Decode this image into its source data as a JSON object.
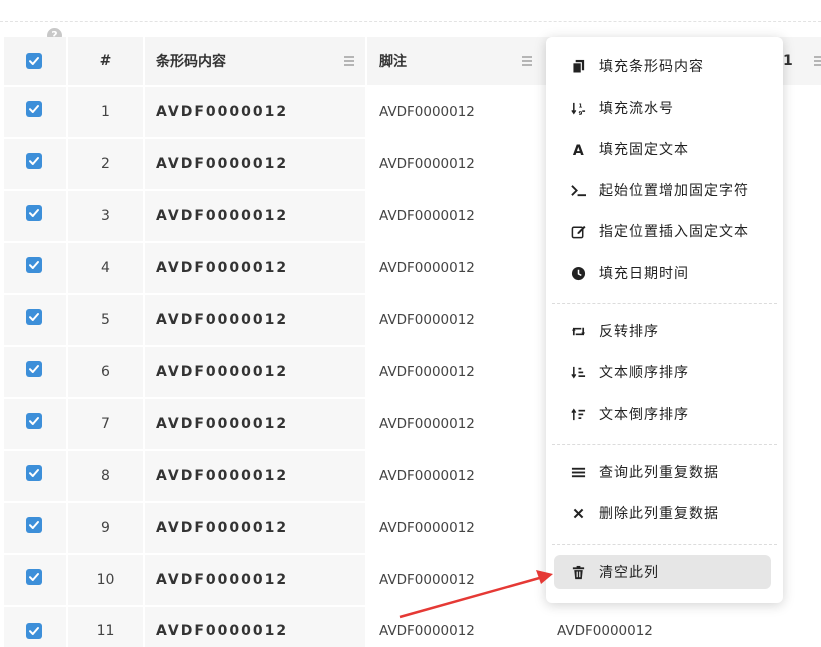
{
  "table": {
    "header": {
      "index": "#",
      "barcode": "条形码内容",
      "note": "脚注",
      "extra_partial": "1"
    },
    "rows": [
      {
        "index": "1",
        "barcode": "AVDF0000012",
        "note": "AVDF0000012"
      },
      {
        "index": "2",
        "barcode": "AVDF0000012",
        "note": "AVDF0000012"
      },
      {
        "index": "3",
        "barcode": "AVDF0000012",
        "note": "AVDF0000012"
      },
      {
        "index": "4",
        "barcode": "AVDF0000012",
        "note": "AVDF0000012"
      },
      {
        "index": "5",
        "barcode": "AVDF0000012",
        "note": "AVDF0000012"
      },
      {
        "index": "6",
        "barcode": "AVDF0000012",
        "note": "AVDF0000012"
      },
      {
        "index": "7",
        "barcode": "AVDF0000012",
        "note": "AVDF0000012"
      },
      {
        "index": "8",
        "barcode": "AVDF0000012",
        "note": "AVDF0000012"
      },
      {
        "index": "9",
        "barcode": "AVDF0000012",
        "note": "AVDF0000012"
      },
      {
        "index": "10",
        "barcode": "AVDF0000012",
        "note": "AVDF0000012"
      },
      {
        "index": "11",
        "barcode": "AVDF0000012",
        "note": "AVDF0000012",
        "extra": "AVDF0000012"
      }
    ],
    "checkbox_color": "#3d8fd9"
  },
  "context_menu": {
    "groups": [
      [
        {
          "label": "填充条形码内容",
          "icon": "copy-icon"
        },
        {
          "label": "填充流水号",
          "icon": "sort-numeric-icon"
        },
        {
          "label": "填充固定文本",
          "icon": "font-icon"
        },
        {
          "label": "起始位置增加固定字符",
          "icon": "terminal-icon"
        },
        {
          "label": "指定位置插入固定文本",
          "icon": "edit-icon"
        },
        {
          "label": "填充日期时间",
          "icon": "clock-icon"
        }
      ],
      [
        {
          "label": "反转排序",
          "icon": "retweet-icon"
        },
        {
          "label": "文本顺序排序",
          "icon": "sort-asc-icon"
        },
        {
          "label": "文本倒序排序",
          "icon": "sort-desc-icon"
        }
      ],
      [
        {
          "label": "查询此列重复数据",
          "icon": "bars-icon"
        },
        {
          "label": "删除此列重复数据",
          "icon": "times-icon"
        }
      ],
      [
        {
          "label": "清空此列",
          "icon": "trash-icon",
          "highlighted": true
        }
      ]
    ]
  },
  "annotation": {
    "arrow_color": "#e53935"
  }
}
